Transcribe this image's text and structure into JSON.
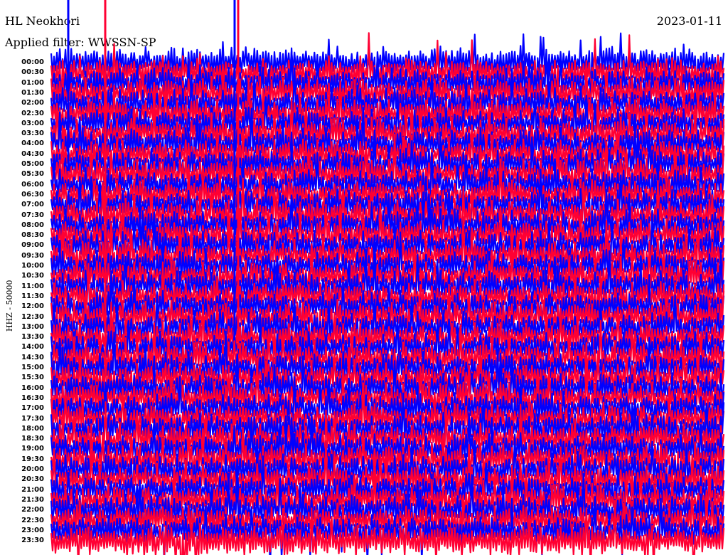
{
  "header": {
    "station": "HL Neokhori",
    "date": "2023-01-11",
    "filter": "Applied filter: WWSSN-SP"
  },
  "chart_data": {
    "type": "line",
    "title": "HL Neokhori",
    "ylabel": "HHZ - 50000",
    "rows": [
      "00:00",
      "00:30",
      "01:00",
      "01:30",
      "02:00",
      "02:30",
      "03:00",
      "03:30",
      "04:00",
      "04:30",
      "05:00",
      "05:30",
      "06:00",
      "06:30",
      "07:00",
      "07:30",
      "08:00",
      "08:30",
      "09:00",
      "09:30",
      "10:00",
      "10:30",
      "11:00",
      "11:30",
      "12:00",
      "12:30",
      "13:00",
      "13:30",
      "14:00",
      "14:30",
      "15:00",
      "15:30",
      "16:00",
      "16:30",
      "17:00",
      "17:30",
      "18:00",
      "18:30",
      "19:00",
      "19:30",
      "20:00",
      "20:30",
      "21:00",
      "21:30",
      "22:00",
      "22:30",
      "23:00",
      "23:30"
    ],
    "row_colors": [
      "#0000ff",
      "#ff0033"
    ],
    "grid": false,
    "legend": "none"
  }
}
